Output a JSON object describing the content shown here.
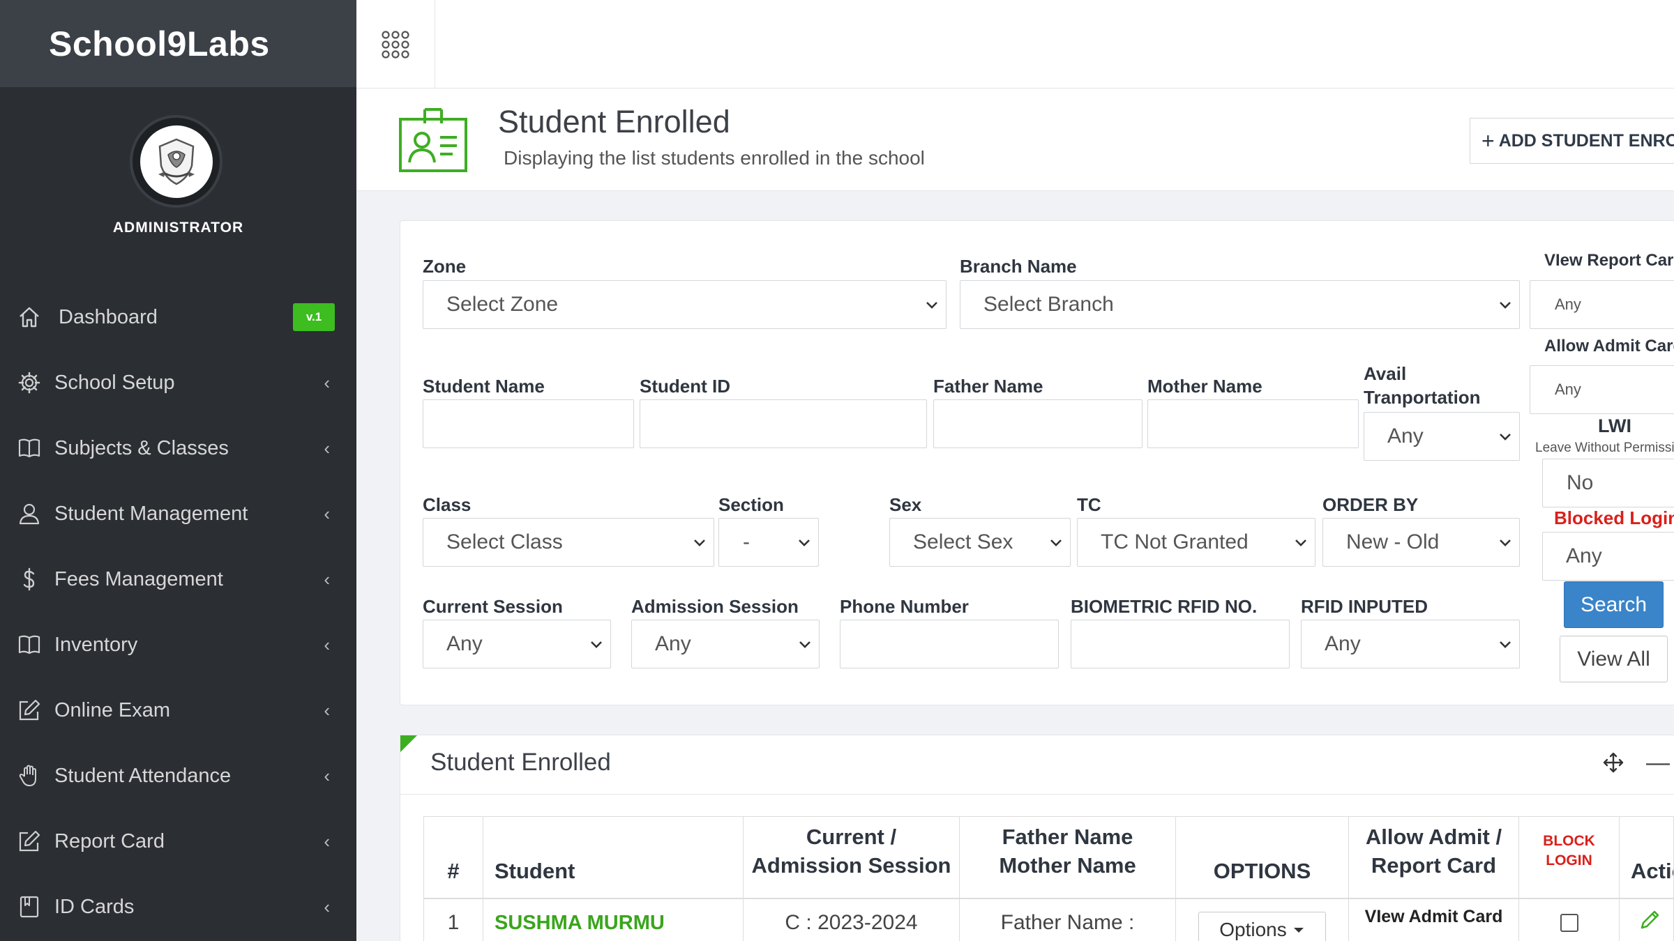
{
  "app": {
    "brand": "School9Labs",
    "role": "ADMINISTRATOR"
  },
  "sidebar": {
    "items": [
      {
        "label": "Dashboard",
        "icon": "home-icon",
        "badge": "v.1"
      },
      {
        "label": "School Setup",
        "icon": "gear-icon"
      },
      {
        "label": "Subjects & Classes",
        "icon": "book-icon"
      },
      {
        "label": "Student Management",
        "icon": "user-icon"
      },
      {
        "label": "Fees Management",
        "icon": "dollar-icon"
      },
      {
        "label": "Inventory",
        "icon": "book-icon"
      },
      {
        "label": "Online Exam",
        "icon": "edit-icon"
      },
      {
        "label": "Student Attendance",
        "icon": "hand-icon"
      },
      {
        "label": "Report Card",
        "icon": "edit-icon"
      },
      {
        "label": "ID Cards",
        "icon": "bookmark-book-icon"
      }
    ],
    "chevron": "‹"
  },
  "header": {
    "title": "Student Enrolled",
    "subtitle": "Displaying the list students enrolled in the school",
    "add_button": "ADD STUDENT ENROLLMENT",
    "accent_color": "#3dae22"
  },
  "filters": {
    "zone": {
      "label": "Zone",
      "value": "Select Zone"
    },
    "branch": {
      "label": "Branch Name",
      "value": "Select Branch"
    },
    "view_report_card": {
      "label": "VIew Report Card",
      "value": "Any"
    },
    "allow_admit_card": {
      "label": "Allow Admit Card",
      "value": "Any"
    },
    "student_name": {
      "label": "Student Name",
      "value": ""
    },
    "student_id": {
      "label": "Student ID",
      "value": ""
    },
    "father_name": {
      "label": "Father Name",
      "value": ""
    },
    "mother_name": {
      "label": "Mother Name",
      "value": ""
    },
    "avail_transport": {
      "label_line1": "Avail",
      "label_line2": "Tranportation",
      "value": "Any"
    },
    "lwi": {
      "title": "LWI",
      "subtitle": "Leave Without Permission",
      "value": "No"
    },
    "class": {
      "label": "Class",
      "value": "Select Class"
    },
    "section": {
      "label": "Section",
      "value": "-"
    },
    "sex": {
      "label": "Sex",
      "value": "Select Sex"
    },
    "tc": {
      "label": "TC",
      "value": "TC Not Granted"
    },
    "order_by": {
      "label": "ORDER BY",
      "value": "New - Old"
    },
    "blocked_login": {
      "label": "Blocked Login",
      "value": "Any"
    },
    "current_session": {
      "label": "Current Session",
      "value": "Any"
    },
    "admission_session": {
      "label": "Admission Session",
      "value": "Any"
    },
    "phone_number": {
      "label": "Phone Number",
      "value": ""
    },
    "biometric_rfid": {
      "label": "BIOMETRIC RFID NO.",
      "value": ""
    },
    "rfid_inputed": {
      "label": "RFID INPUTED",
      "value": "Any"
    },
    "search_button": "Search",
    "view_all_button": "View All"
  },
  "results": {
    "title": "Student Enrolled",
    "columns": {
      "index": "#",
      "student": "Student",
      "session_line1": "Current /",
      "session_line2": "Admission Session",
      "parents_line1": "Father Name",
      "parents_line2": "Mother Name",
      "options": "OPTIONS",
      "admit_line1": "Allow Admit /",
      "admit_line2": "Report Card",
      "block_line1": "BLOCK",
      "block_line2": "LOGIN",
      "action": "Action"
    },
    "rows": [
      {
        "index": "1",
        "student": "SUSHMA MURMU",
        "session": "C : 2023-2024",
        "father": "Father Name :",
        "options_label": "Options",
        "admit": "VIew Admit Card"
      }
    ]
  }
}
